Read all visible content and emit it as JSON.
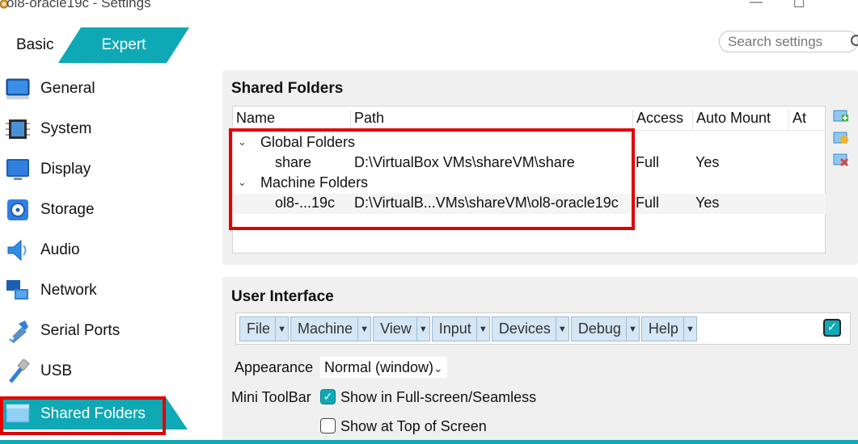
{
  "window": {
    "title": "ol8-oracle19c - Settings",
    "minimize_glyph": "—",
    "maximize_glyph": "☐"
  },
  "mode_tabs": {
    "basic": "Basic",
    "expert": "Expert"
  },
  "search": {
    "placeholder": "Search settings"
  },
  "sidebar": {
    "items": [
      {
        "label": "General",
        "icon": "general-icon"
      },
      {
        "label": "System",
        "icon": "system-icon"
      },
      {
        "label": "Display",
        "icon": "display-icon"
      },
      {
        "label": "Storage",
        "icon": "storage-icon"
      },
      {
        "label": "Audio",
        "icon": "audio-icon"
      },
      {
        "label": "Network",
        "icon": "network-icon"
      },
      {
        "label": "Serial Ports",
        "icon": "serial-ports-icon"
      },
      {
        "label": "USB",
        "icon": "usb-icon"
      },
      {
        "label": "Shared Folders",
        "icon": "shared-folders-icon",
        "active": true
      }
    ]
  },
  "shared_folders": {
    "heading": "Shared Folders",
    "columns": [
      "Name",
      "Path",
      "Access",
      "Auto Mount",
      "At"
    ],
    "groups": [
      {
        "label": "Global Folders",
        "rows": [
          {
            "name": "share",
            "path": "D:\\VirtualBox VMs\\shareVM\\share",
            "access": "Full",
            "auto_mount": "Yes",
            "at": ""
          }
        ]
      },
      {
        "label": "Machine Folders",
        "rows": [
          {
            "name": "ol8-...19c",
            "path": "D:\\VirtualB...VMs\\shareVM\\ol8-oracle19c",
            "access": "Full",
            "auto_mount": "Yes",
            "at": ""
          }
        ]
      }
    ]
  },
  "user_interface": {
    "heading": "User Interface",
    "menus": [
      "File",
      "Machine",
      "View",
      "Input",
      "Devices",
      "Debug",
      "Help"
    ],
    "menubar_enabled": true,
    "appearance_label": "Appearance",
    "appearance_value": "Normal (window)",
    "mini_toolbar_label": "Mini ToolBar",
    "show_fullscreen_label": "Show in Full-screen/Seamless",
    "show_fullscreen_checked": true,
    "show_top_label": "Show at Top of Screen",
    "show_top_checked": false
  },
  "colors": {
    "accent": "#0fa9b5",
    "highlight": "#e00000"
  }
}
